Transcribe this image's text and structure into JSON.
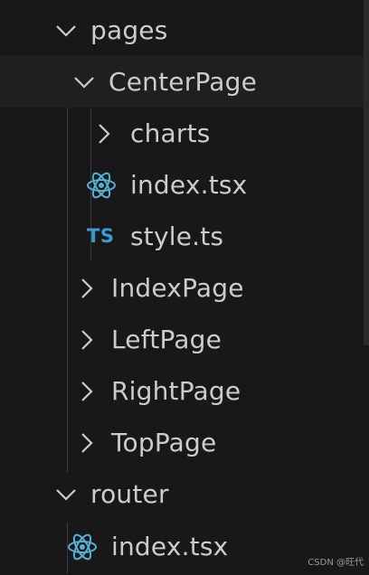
{
  "explorer": {
    "pages_folder": "pages",
    "center_page_folder": "CenterPage",
    "charts_folder": "charts",
    "center_index_file": "index.tsx",
    "style_file_icon": "TS",
    "style_file": "style.ts",
    "index_page_folder": "IndexPage",
    "left_page_folder": "LeftPage",
    "right_page_folder": "RightPage",
    "top_page_folder": "TopPage",
    "router_folder": "router",
    "router_index_file": "index.tsx"
  },
  "watermark": "CSDN @旺代",
  "colors": {
    "background": "#181818",
    "text": "#cccccc",
    "react_icon": "#53b1d8",
    "ts_icon": "#3b9ad3"
  },
  "icons": {
    "expanded": "chevron-down-icon",
    "collapsed": "chevron-right-icon",
    "tsx_file": "react-icon",
    "ts_file": "typescript-icon"
  }
}
